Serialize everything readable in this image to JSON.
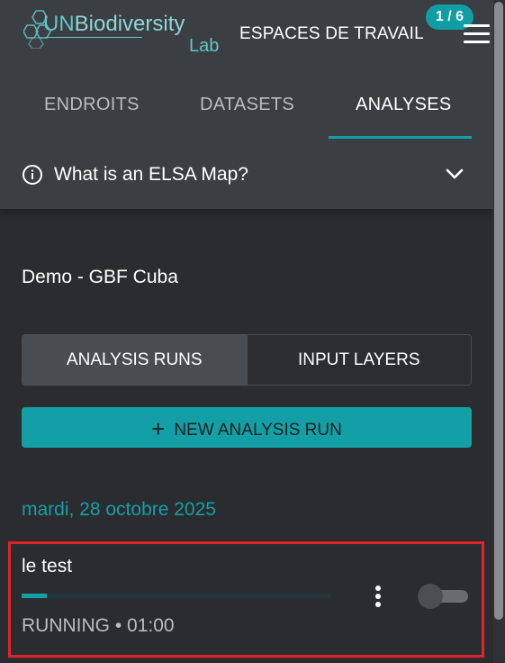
{
  "header": {
    "logo_prefix": "UN",
    "logo_main": "Biodiversity",
    "logo_sub": "Lab",
    "workspaces_label": "ESPACES DE TRAVAIL",
    "badge": "1 / 6",
    "menu_icon": "hamburger-menu-icon"
  },
  "tabs": [
    {
      "label": "ENDROITS",
      "active": false
    },
    {
      "label": "DATASETS",
      "active": false
    },
    {
      "label": "ANALYSES",
      "active": true
    }
  ],
  "info": {
    "icon": "info-icon",
    "text": "What is an ELSA Map?",
    "chevron_icon": "chevron-down-icon"
  },
  "project": {
    "title": "Demo - GBF Cuba"
  },
  "segmented": {
    "options": [
      {
        "label": "ANALYSIS RUNS",
        "active": true
      },
      {
        "label": "INPUT LAYERS",
        "active": false
      }
    ]
  },
  "new_run": {
    "label": "NEW ANALYSIS RUN",
    "icon": "plus-icon"
  },
  "runs": {
    "date": "mardi, 28 octobre 2025",
    "items": [
      {
        "name": "le test",
        "status": "RUNNING • 01:00",
        "progress": 0.08,
        "toggle_on": false
      }
    ]
  },
  "colors": {
    "accent": "#12a0a6",
    "highlight_border": "#e0242b",
    "background": "#2a2c2f",
    "header_bg": "#3b3e42"
  }
}
